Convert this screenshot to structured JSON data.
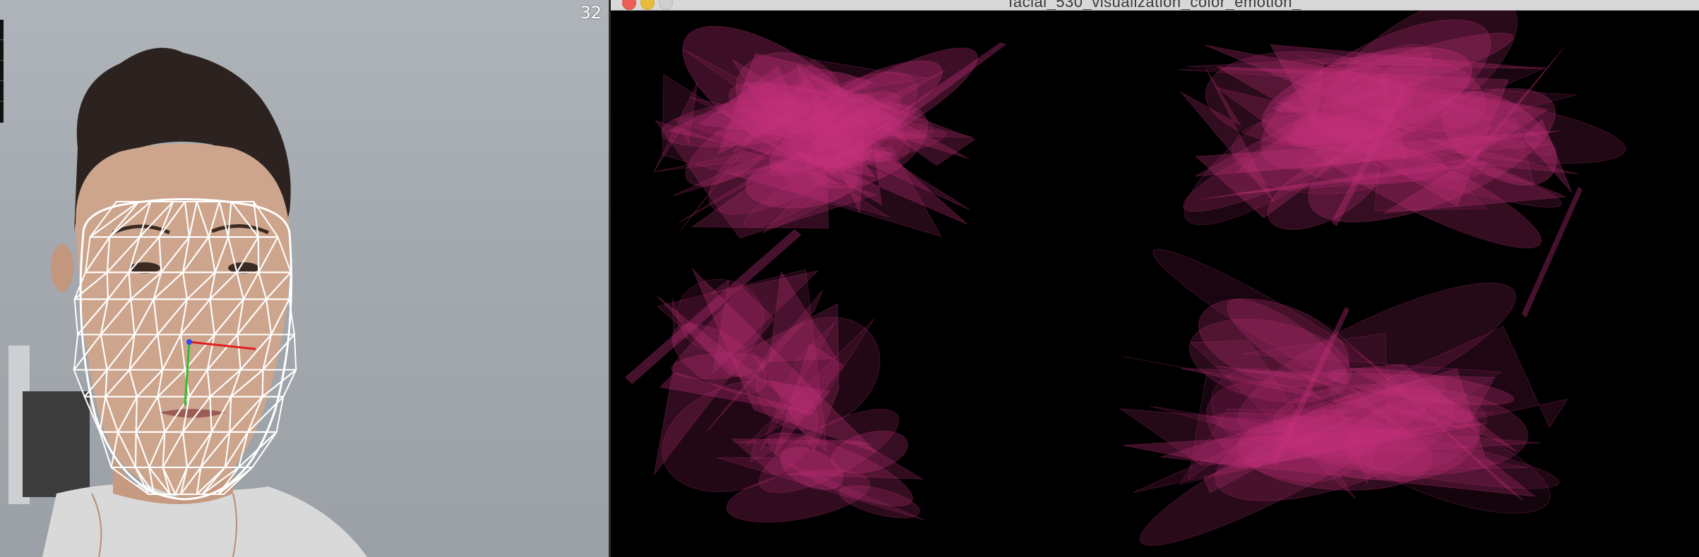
{
  "webcam": {
    "fps_counter": "32"
  },
  "visualization_window": {
    "title": "facial_530_visualization_color_emotion_",
    "controls": {
      "close_icon": "close-icon",
      "minimize_icon": "minimize-icon",
      "zoom_icon": "zoom-icon"
    }
  },
  "colors": {
    "mesh": "#ffffff",
    "shape_fill": "#c8327d",
    "axis_x": "#e02020",
    "axis_y": "#2ec02e",
    "axis_z": "#2a4bff",
    "titlebar": "#d8d8d8",
    "close": "#ec5f57",
    "minimize": "#e9bb3a"
  }
}
